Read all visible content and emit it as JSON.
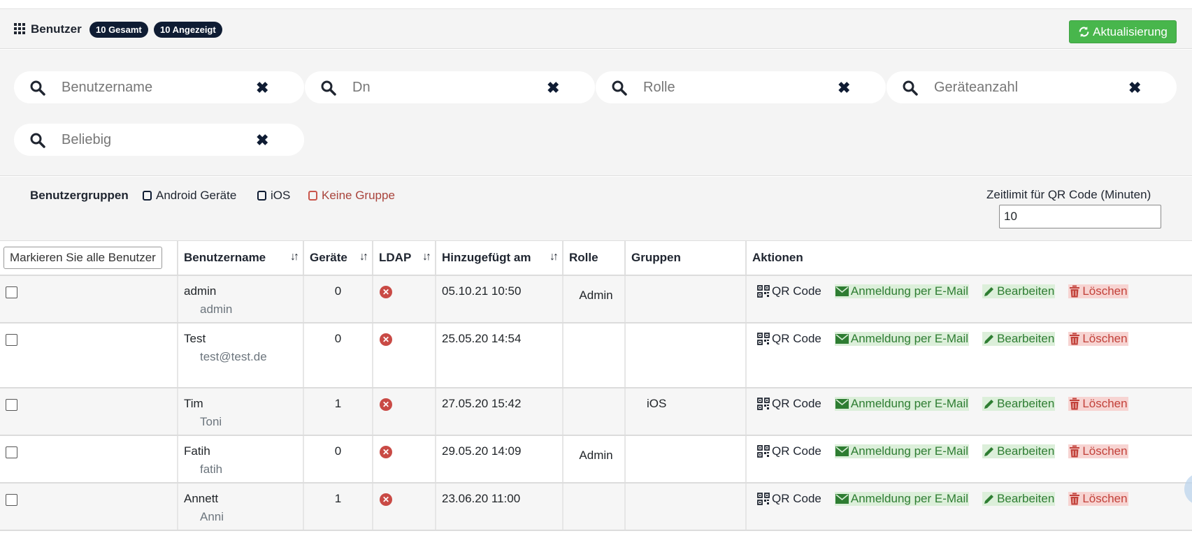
{
  "header": {
    "title": "Benutzer",
    "badge_total": "10 Gesamt",
    "badge_shown": "10 Angezeigt",
    "refresh_label": "Aktualisierung"
  },
  "filters": {
    "username_placeholder": "Benutzername",
    "dn_placeholder": "Dn",
    "role_placeholder": "Rolle",
    "devices_placeholder": "Geräteanzahl",
    "any_placeholder": "Beliebig"
  },
  "groups": {
    "label": "Benutzergruppen",
    "options": [
      "Android Geräte",
      "iOS",
      "Keine Gruppe"
    ]
  },
  "qr_timeout": {
    "label": "Zeitlimit für QR Code (Minuten)",
    "value": "10"
  },
  "table": {
    "mark_all_label": "Markieren Sie alle Benutzer",
    "columns": [
      "Benutzername",
      "Geräte",
      "LDAP",
      "Hinzugefügt am",
      "Rolle",
      "Gruppen",
      "Aktionen"
    ],
    "actions": {
      "qr": "QR Code",
      "mail": "Anmeldung per E-Mail",
      "edit": "Bearbeiten",
      "delete": "Löschen"
    },
    "rows": [
      {
        "username": "admin",
        "dn": "admin",
        "devices": "0",
        "added": "05.10.21 10:50",
        "role": "Admin",
        "groups": ""
      },
      {
        "username": "Test",
        "dn": "test@test.de",
        "devices": "0",
        "added": "25.05.20 14:54",
        "role": "",
        "groups": ""
      },
      {
        "username": "Tim",
        "dn": "Toni",
        "devices": "1",
        "added": "27.05.20 15:42",
        "role": "",
        "groups": "iOS"
      },
      {
        "username": "Fatih",
        "dn": "fatih",
        "devices": "0",
        "added": "29.05.20 14:09",
        "role": "Admin",
        "groups": ""
      },
      {
        "username": "Annett",
        "dn": "Anni",
        "devices": "1",
        "added": "23.06.20 11:00",
        "role": "",
        "groups": ""
      }
    ]
  },
  "colors": {
    "navy": "#0f1c33",
    "success": "#48b64c",
    "danger": "#c94a45"
  }
}
